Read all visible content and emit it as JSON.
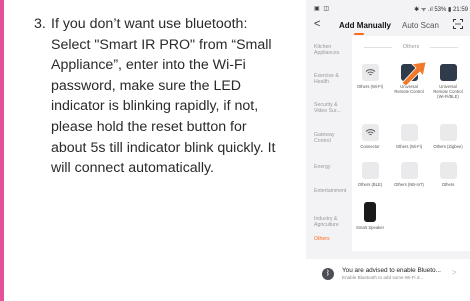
{
  "instructions": {
    "step_number": "3.",
    "text": "If you don’t want use bluetooth: Select \"Smart IR PRO\" from “Small Appliance”, enter into the Wi-Fi password, make sure the LED indicator is blinking rapidly, if not, please hold the reset button for about 5s till indicator blink quickly. It will connect automatically."
  },
  "status_bar": {
    "left_icons": "▣ ◫",
    "right": "✱ ᯤ .ıl 53% ▮ 21:59"
  },
  "header": {
    "back": "<",
    "tab_manual": "Add Manually",
    "tab_scan": "Auto Scan"
  },
  "sidebar": {
    "items": [
      "Kitchen Appliances",
      "Exercise & Health",
      "Security & Video Sur...",
      "Gateway Control",
      "Energy",
      "Entertainment",
      "Industry & Agriculture",
      "Others"
    ]
  },
  "content": {
    "section_title": "Others",
    "tiles": [
      "Others (Wi-Fi)",
      "Universal Remote Control",
      "Universal Remote Control (Wi-Fi/BLE)",
      "Connector",
      "Others (Wi-Fi)",
      "Others (Zigbee)",
      "Others (BLE)",
      "Others (NB-IoT)",
      "Others",
      "Smart Speaker"
    ]
  },
  "notice": {
    "title": "You are advised to enable Blueto...",
    "subtitle": "Enable Bluetooth to add some Wi-Fi d...",
    "chevron": ">"
  },
  "colors": {
    "accent": "#ff6a1a",
    "left_bar": "#e4519a",
    "remote_tile": "#2f3b4a"
  }
}
